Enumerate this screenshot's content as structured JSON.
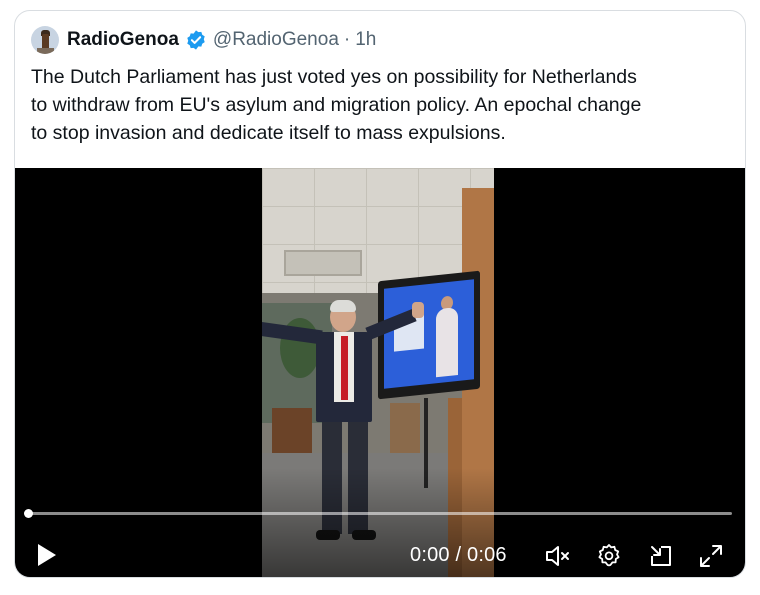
{
  "tweet": {
    "display_name": "RadioGenoa",
    "handle": "@RadioGenoa",
    "separator": "·",
    "time": "1h",
    "verified": true,
    "text": "The Dutch Parliament has just voted yes on possibility for Netherlands\nto withdraw from EU's asylum and migration policy. An epochal change\nto stop invasion and dedicate itself to mass expulsions."
  },
  "video": {
    "time_display": "0:00 / 0:06",
    "progress_fraction": 0.0,
    "controls": {
      "play_icon": "play-icon",
      "mute_icon": "speaker-muted-icon",
      "settings_icon": "gear-icon",
      "pip_icon": "picture-in-picture-icon",
      "fullscreen_icon": "fullscreen-expand-icon"
    }
  },
  "colors": {
    "verified_blue": "#1d9bf0",
    "text_primary": "#0f1419",
    "text_secondary": "#536471",
    "border": "#d9dde1"
  }
}
